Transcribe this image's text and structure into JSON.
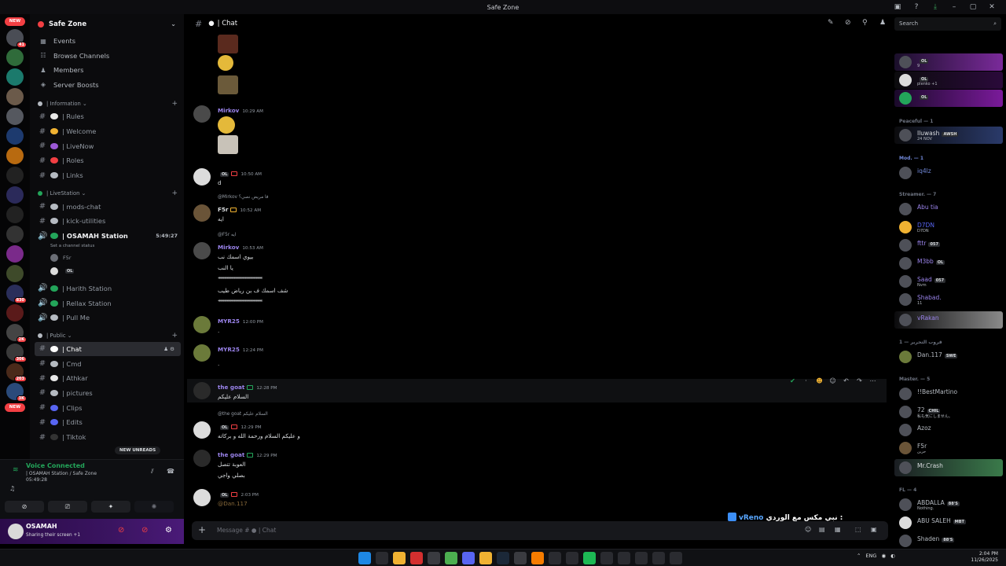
{
  "window": {
    "title": "Safe Zone"
  },
  "rail": {
    "new_top": "NEW",
    "new_bottom": "NEW",
    "badges": [
      "41",
      "830",
      "2K",
      "306",
      "203",
      "3K"
    ]
  },
  "guild": {
    "name": "Safe Zone",
    "nav": [
      {
        "label": "Events",
        "icon": "calendar-icon"
      },
      {
        "label": "Browse Channels",
        "icon": "browse-icon"
      },
      {
        "label": "Members",
        "icon": "members-icon"
      },
      {
        "label": "Server Boosts",
        "icon": "boost-icon"
      }
    ],
    "categories": {
      "information": "| Information",
      "livestation": "| LiveStation",
      "public": "| Public"
    },
    "info_channels": [
      "| Rules",
      "| Welcome",
      "| LiveNow",
      "| Roles",
      "| Links"
    ],
    "live_channels": [
      "| mods-chat",
      "| kick-utilities"
    ],
    "voice_active": {
      "name": "| OSAMAH Station",
      "time": "5:49:27",
      "status": "Set a channel status",
      "users": [
        "F5r",
        "OL"
      ]
    },
    "voice_channels": [
      "| Harith Station",
      "| Rellax Station",
      "| Pull Me"
    ],
    "public_channels": [
      "| Chat",
      "| Cmd",
      "| Athkar",
      "| pictures",
      "| Clips",
      "| Edits",
      "| Tiktok"
    ],
    "new_unreads": "NEW UNREADS"
  },
  "voice": {
    "title": "Voice Connected",
    "where": "| OSAMAH Station / Safe Zone",
    "time": "05:49:28"
  },
  "user": {
    "name": "OSAMAH",
    "status": "Sharing their screen +1"
  },
  "chat": {
    "channel": "| Chat",
    "composer_placeholder": "Message # ● | Chat",
    "messages": [
      {
        "name": "Mirkov",
        "time": "10:29 AM"
      },
      {
        "name": "OL",
        "time": "10:50 AM",
        "text": "d"
      },
      {
        "reply": "@Mirkov فا مريض نصي؟",
        "name": "F5r",
        "time": "10:52 AM",
        "text": "ايه"
      },
      {
        "reply": "@F5r ايه",
        "name": "Mirkov",
        "time": "10:53 AM",
        "lines": [
          "بيوي اسمك نب",
          "يا النب",
          "‹‹‹‹‹‹‹‹‹‹‹‹‹‹‹‹‹‹‹‹‹‹‹‹‹‹‹‹‹‹‹‹‹‹‹‹‹‹‹‹‹‹‹‹‹‹‹‹‹‹‹‹‹‹‹‹‹‹‹‹‹‹‹‹‹‹‹‹‹‹‹‹‹‹‹‹‹‹‹‹",
          "شف اسمك ف بن رياض طيب",
          "‹‹‹‹‹‹‹‹‹‹‹‹‹‹‹‹‹‹‹‹‹‹‹‹‹‹‹‹‹‹‹‹‹‹‹‹‹‹‹‹‹‹‹‹‹‹‹‹‹‹‹‹‹‹‹‹‹‹‹‹‹‹‹‹‹‹‹‹‹‹‹‹‹‹‹‹‹‹‹‹"
        ]
      },
      {
        "name": "MYR25",
        "time": "12:00 PM",
        "text": "."
      },
      {
        "name": "MYR25",
        "time": "12:24 PM",
        "text": "."
      },
      {
        "name": "the goat",
        "time": "12:28 PM",
        "text": "السلام عليكم"
      },
      {
        "reply": "@the goat السلام عليكم",
        "name": "OL",
        "time": "12:29 PM",
        "text": "و عليكم السلام ورحمة الله و بركاته"
      },
      {
        "name": "the goat",
        "time": "12:29 PM",
        "lines": [
          "العوبة تتصل",
          "بصلي واجي"
        ]
      },
      {
        "name": "OL",
        "time": "2:03 PM",
        "text": "@Dan.117"
      }
    ]
  },
  "now_playing": {
    "name": "vReno",
    "title": "نبي مكس مع الوردي :"
  },
  "search": {
    "placeholder": "Search"
  },
  "members": {
    "groups": [
      "Peaceful — 1",
      "Mod. — 1",
      "Streamer. — 7",
      "قروب التحرير — 1",
      "Master. — 5",
      "FL — 4"
    ],
    "top": [
      {
        "name": "OL",
        "sub": "9"
      },
      {
        "name": "OL",
        "sub": "plenko +1"
      },
      {
        "name": "OL",
        "sub": ""
      }
    ],
    "peaceful": [
      {
        "name": "Iluwash",
        "tag": "AWSH",
        "sub": "24 NOV"
      }
    ],
    "mod": [
      {
        "name": "iq4lz"
      }
    ],
    "streamer": [
      {
        "name": "Abu tia"
      },
      {
        "name": "D7DN",
        "sub": "D7DN"
      },
      {
        "name": "fttr",
        "tag": "057"
      },
      {
        "name": "M3bb",
        "tag": "OL"
      },
      {
        "name": "Saad",
        "tag": "057",
        "sub": "Nvm"
      },
      {
        "name": "Shabad.",
        "sub": "11"
      },
      {
        "name": "vRakan"
      }
    ],
    "group4": [
      {
        "name": "Dan.117",
        "tag": "SWE"
      }
    ],
    "master": [
      {
        "name": "!!BestMartino"
      },
      {
        "name": "72",
        "tag": "CHIL",
        "sub": "私も気にしません。"
      },
      {
        "name": "Azoz"
      },
      {
        "name": "F5r",
        "sub": "حزين"
      },
      {
        "name": "Mr.Crash"
      }
    ],
    "fl": [
      {
        "name": "ABDALLA",
        "tag": "88'S",
        "sub": "Nothing."
      },
      {
        "name": "ABU SALEH",
        "tag": "MBT"
      },
      {
        "name": "Shaden",
        "tag": "88'S"
      }
    ]
  },
  "taskbar": {
    "lang": "ENG",
    "time": "2:04 PM",
    "date": "11/26/2025"
  }
}
